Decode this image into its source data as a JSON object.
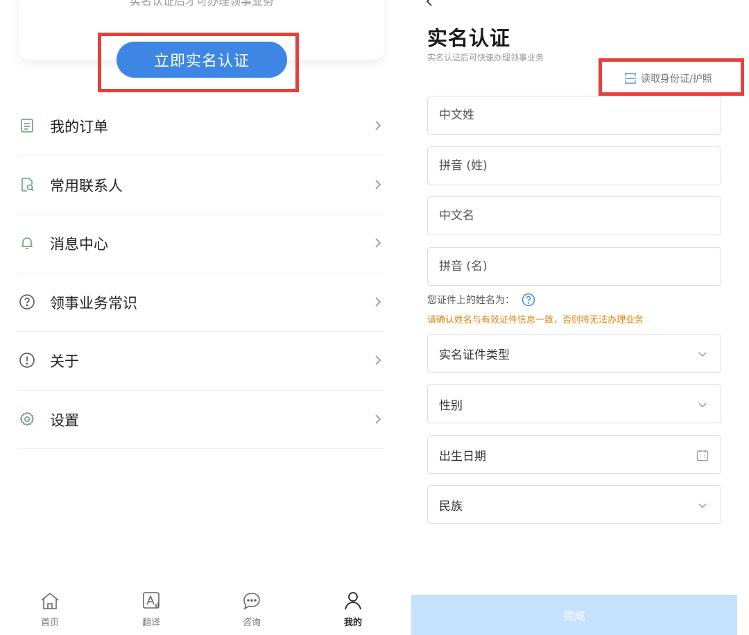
{
  "left": {
    "auth_card": {
      "hint": "实名认证后才可办理领事业务",
      "button_label": "立即实名认证"
    },
    "menu": [
      {
        "label": "我的订单",
        "icon": "document-icon"
      },
      {
        "label": "常用联系人",
        "icon": "contacts-search-icon"
      },
      {
        "label": "消息中心",
        "icon": "bell-icon"
      },
      {
        "label": "领事业务常识",
        "icon": "question-circle-icon"
      },
      {
        "label": "关于",
        "icon": "info-circle-icon"
      },
      {
        "label": "设置",
        "icon": "gear-icon"
      }
    ],
    "tabs": [
      {
        "label": "首页",
        "icon": "home-icon"
      },
      {
        "label": "翻译",
        "icon": "translate-icon"
      },
      {
        "label": "咨询",
        "icon": "chat-icon"
      },
      {
        "label": "我的",
        "icon": "user-icon",
        "active": true
      }
    ]
  },
  "right": {
    "title": "实名认证",
    "subtitle": "实名认证后可快速办理领事业务",
    "scan_label": "读取身份证/护照",
    "fields": {
      "surname_cn": "中文姓",
      "surname_pinyin": "拼音 (姓)",
      "given_cn": "中文名",
      "given_pinyin": "拼音 (名)"
    },
    "name_note": "您证件上的姓名为：",
    "warning": "请确认姓名与有效证件信息一致，否则将无法办理业务",
    "selects": {
      "id_type": "实名证件类型",
      "gender": "性别",
      "birth_date": "出生日期",
      "ethnicity": "民族"
    },
    "submit_label": "完成"
  },
  "colors": {
    "primary": "#3d86e3",
    "highlight": "#e5403b",
    "warning": "#e1860e",
    "submit_disabled": "#c5e1fb"
  }
}
